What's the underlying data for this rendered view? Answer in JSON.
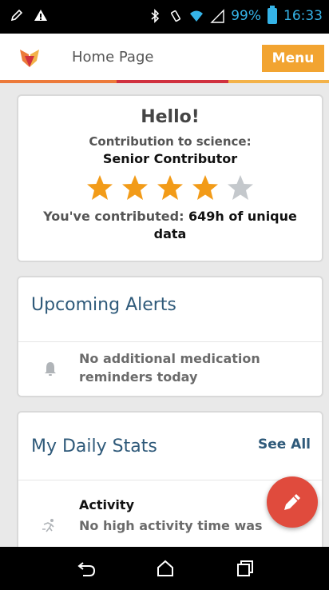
{
  "status_bar": {
    "battery_percent": "99%",
    "time": "16:33",
    "icons": [
      "edit-icon",
      "warning-icon",
      "bluetooth-icon",
      "vibrate-icon",
      "wifi-icon",
      "signal-icon",
      "battery-icon"
    ]
  },
  "header": {
    "title": "Home Page",
    "menu_label": "Menu",
    "logo_icon": "app-logo-icon",
    "rule_colors": [
      "#ec7a3a",
      "#d0313f",
      "#f3b249"
    ]
  },
  "hello_card": {
    "greeting": "Hello!",
    "contribution_label": "Contribution to science:",
    "contribution_level": "Senior Contributor",
    "rating": 4,
    "rating_max": 5,
    "contributed_label": "You've contributed: ",
    "contributed_value": "649h of unique data"
  },
  "alerts_card": {
    "title": "Upcoming Alerts",
    "alert_text": "No additional medication reminders today",
    "icon": "bell-icon"
  },
  "stats_card": {
    "title": "My Daily Stats",
    "see_all_label": "See All",
    "activity_title": "Activity",
    "activity_text": "No high activity time was",
    "icon": "activity-icon"
  },
  "fab": {
    "icon": "pencil-icon",
    "color": "#e04b3d"
  },
  "colors": {
    "accent": "#f2a431",
    "title_blue": "#2f5a7a",
    "star_filled": "#f29b18",
    "star_empty": "#c4c8cc"
  }
}
